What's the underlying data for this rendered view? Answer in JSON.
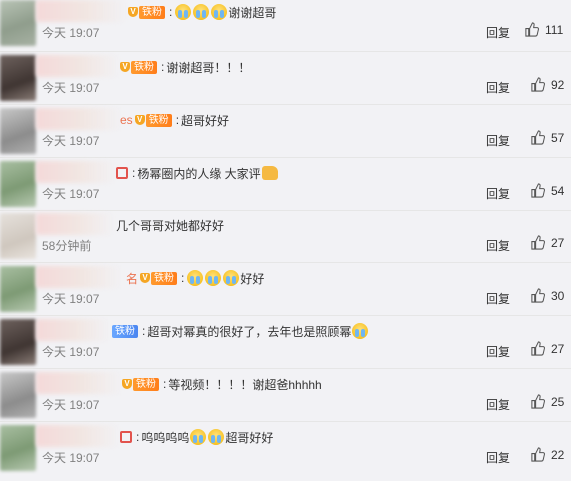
{
  "comments": [
    {
      "text": "谢谢超哥",
      "fan_badge": "铁粉",
      "time": "今天 19:07",
      "reply": "回复",
      "likes": "111"
    },
    {
      "text": "谢谢超哥！！！",
      "fan_badge": "铁粉",
      "time": "今天 19:07",
      "reply": "回复",
      "likes": "92"
    },
    {
      "text": "超哥好好",
      "nick_tail": "es",
      "fan_badge": "铁粉",
      "time": "今天 19:07",
      "reply": "回复",
      "likes": "57"
    },
    {
      "text": "杨幂圈内的人缘 大家评",
      "time": "今天 19:07",
      "reply": "回复",
      "likes": "54"
    },
    {
      "text": "几个哥哥对她都好好",
      "time": "58分钟前",
      "reply": "回复",
      "likes": "27"
    },
    {
      "text": "好好",
      "nick_tail": "名",
      "fan_badge": "铁粉",
      "time": "今天 19:07",
      "reply": "回复",
      "likes": "30"
    },
    {
      "text": "超哥对幂真的很好了，去年也是照顾幂",
      "fan_badge": "铁粉",
      "time": "今天 19:07",
      "reply": "回复",
      "likes": "27"
    },
    {
      "text": "等视频！！！！谢超爸hhhhh",
      "fan_badge": "铁粉",
      "time": "今天 19:07",
      "reply": "回复",
      "likes": "25"
    },
    {
      "text": "呜呜呜呜",
      "text_after": "超哥好好",
      "time": "今天 19:07",
      "reply": "回复",
      "likes": "22"
    }
  ],
  "icons": {
    "like": "thumbs-up-icon",
    "emoji": "crying-face-emoji",
    "fan": "crown-icon"
  },
  "colors": {
    "background": "#f2f2f5",
    "nick": "#eb7350",
    "fan_badge": "#ff8c24",
    "meta": "#808080"
  }
}
